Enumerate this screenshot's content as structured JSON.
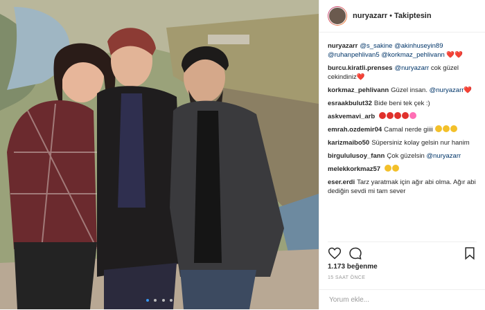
{
  "header": {
    "username": "nuryazarr",
    "separator": "•",
    "follow_status": "Takiptesin"
  },
  "comments": [
    {
      "user": "nuryazarr",
      "text": "@s_sakine @akinhuseyin89 @ruhanpehlivan5 @korkmaz_pehlivann ❤️❤️"
    },
    {
      "user": "burcu.kiratli.prenses",
      "text": "@nuryazarr cok güzel cekindiniz❤️"
    },
    {
      "user": "korkmaz_pehlivann",
      "text": "Güzel insan. @nuryazarr❤️"
    },
    {
      "user": "esraakbulut32",
      "text": "Bide beni tek çek :)"
    },
    {
      "user": "askvemavi_arb",
      "text": ""
    },
    {
      "user": "emrah.ozdemir04",
      "text": "Camal nerde giiii"
    },
    {
      "user": "karizmaibo50",
      "text": "Süpersiniz kolay gelsin nur hanim"
    },
    {
      "user": "birgululusoy_fann",
      "text": "Çok güzelsin @nuryazarr"
    },
    {
      "user": "melekkorkmaz57",
      "text": ""
    },
    {
      "user": "eser.erdi",
      "text": "Tarz yaratmak için ağır abi olma. Ağır abi dediğin sevdi mi tam sever"
    }
  ],
  "likes": "1.173 beğenme",
  "time": "15 SAAT ÖNCE",
  "add_comment": {
    "placeholder": "Yorum ekle..."
  },
  "icons": {
    "like": "heart-icon",
    "comment": "comment-bubble-icon",
    "save": "bookmark-icon"
  },
  "carousel": {
    "pages": 4,
    "active": 1
  },
  "colors": {
    "link": "#3897f0",
    "text": "#262626",
    "muted": "#999999",
    "border": "#efefef"
  }
}
